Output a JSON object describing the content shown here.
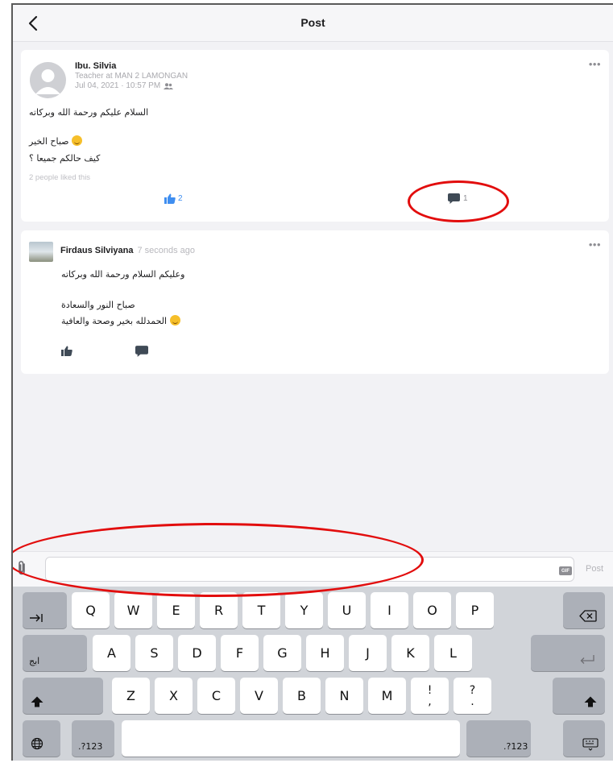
{
  "header": {
    "title": "Post"
  },
  "post": {
    "author": "Ibu. Silvia",
    "role": "Teacher at MAN 2 LAMONGAN",
    "timestamp": "Jul 04, 2021 · 10:57 PM",
    "lines": [
      "السلام عليكم ورحمة الله وبركاته",
      "صباح الخير",
      "كيف حالكم جميعا ؟"
    ],
    "liked_text": "2 people liked this",
    "like_count": "2",
    "comment_count": "1",
    "more": "•••"
  },
  "comment": {
    "author": "Firdaus Silviyana",
    "time": "7 seconds ago",
    "lines": [
      "وعليكم السلام ورحمة الله وبركاته",
      "صباح النور والسعادة",
      "الحمدلله بخير وصحة والعافية"
    ],
    "more": "•••"
  },
  "input_bar": {
    "placeholder": "",
    "post_label": "Post",
    "gif_label": "GIF"
  },
  "keyboard": {
    "row1": [
      "Q",
      "W",
      "E",
      "R",
      "T",
      "Y",
      "U",
      "I",
      "O",
      "P"
    ],
    "row2": [
      "A",
      "S",
      "D",
      "F",
      "G",
      "H",
      "J",
      "K",
      "L"
    ],
    "row3": [
      "Z",
      "X",
      "C",
      "V",
      "B",
      "N",
      "M"
    ],
    "punct1_top": "!",
    "punct1_bottom": ",",
    "punct2_top": "?",
    "punct2_bottom": ".",
    "lang_key": "ابج",
    "num_left": ".?123",
    "num_right": ".?123"
  },
  "colors": {
    "accent": "#3f8ef0",
    "annotation": "#e20d0d",
    "keyboard_bg": "#d1d4d9"
  },
  "icons": [
    "chevron-left-icon",
    "more-icon",
    "group-icon",
    "thumbs-up-icon",
    "comment-bubble-icon",
    "paperclip-icon",
    "gif-icon",
    "tab-icon",
    "backspace-icon",
    "return-icon",
    "shift-icon",
    "globe-icon",
    "keyboard-dismiss-icon"
  ]
}
